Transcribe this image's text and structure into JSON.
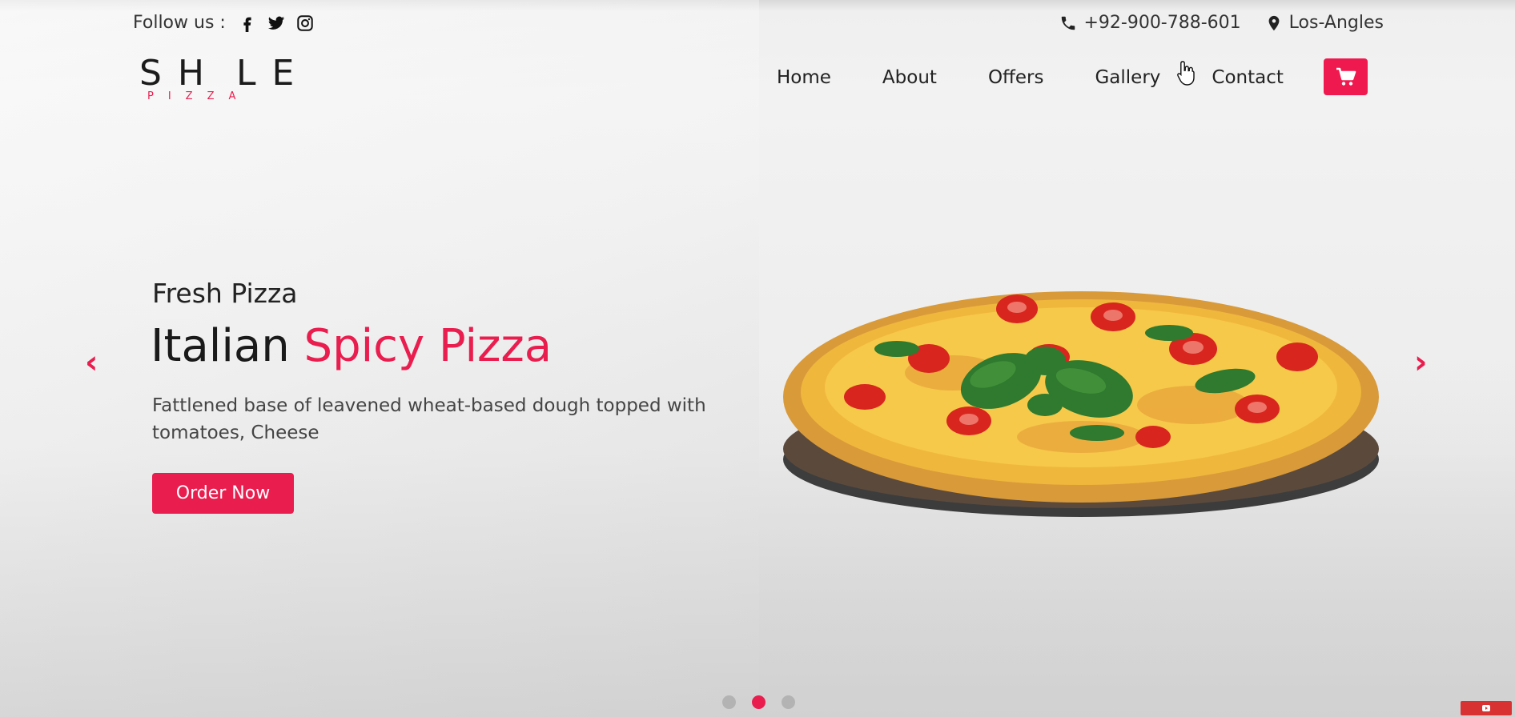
{
  "topbar": {
    "follow_label": "Follow us :",
    "social": [
      "facebook-icon",
      "twitter-icon",
      "instagram-icon"
    ],
    "phone": "+92-900-788-601",
    "location": "Los-Angles"
  },
  "logo": {
    "brand": "SH",
    "brand_end": "LE",
    "sub": "PIZZA"
  },
  "nav": {
    "items": [
      "Home",
      "About",
      "Offers",
      "Gallery",
      "Contact"
    ]
  },
  "cart": {
    "icon": "cart-icon"
  },
  "hero": {
    "subtitle": "Fresh Pizza",
    "title_main": "Italian",
    "title_accent": "Spicy Pizza",
    "description": "Fattlened base of leavened wheat-based dough topped with tomatoes, Cheese",
    "cta": "Order Now"
  },
  "carousel": {
    "prev": "‹",
    "next": "›",
    "total_slides": 3,
    "active_slide": 2
  },
  "colors": {
    "accent": "#e91e4f",
    "text_dark": "#1a1a1a"
  }
}
